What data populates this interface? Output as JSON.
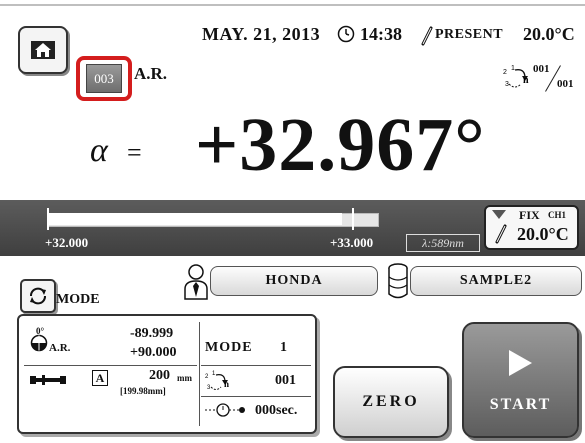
{
  "header": {
    "date": "MAY. 21, 2013",
    "time": "14:38",
    "present_label": "PRESENT",
    "temperature": "20.0°C"
  },
  "method": {
    "code": "003",
    "label": "A.R."
  },
  "counter": {
    "current": "001",
    "total": "001"
  },
  "measurement": {
    "symbol": "α",
    "equals": "=",
    "value": "+32.967°"
  },
  "scale": {
    "min_label": "+32.000",
    "max_label": "+33.000",
    "position": 0.967,
    "wavelength": "λ:589nm"
  },
  "fix": {
    "label": "FIX",
    "channel": "CH1",
    "temperature": "20.0°C"
  },
  "mode_button": {
    "label": "MODE"
  },
  "operator": {
    "name": "HONDA"
  },
  "sample": {
    "name": "SAMPLE2"
  },
  "params": {
    "angle_unit": "0°",
    "range_label": "A.R.",
    "range_low": "-89.999",
    "range_high": "+90.000",
    "tube_code": "A",
    "tube_length": "200",
    "tube_length_unit": "mm",
    "tube_length_actual": "[199.98mm]",
    "mode_label": "MODE",
    "mode_value": "1",
    "repeat_value": "001",
    "wait_value": "000sec."
  },
  "buttons": {
    "zero": "ZERO",
    "start": "START"
  },
  "icons": [
    "home-icon",
    "clock-icon",
    "thermometer-icon",
    "repeat-icon",
    "mode-cycle-icon",
    "person-icon",
    "database-icon",
    "protractor-icon",
    "tube-icon",
    "timer-icon",
    "play-icon"
  ]
}
